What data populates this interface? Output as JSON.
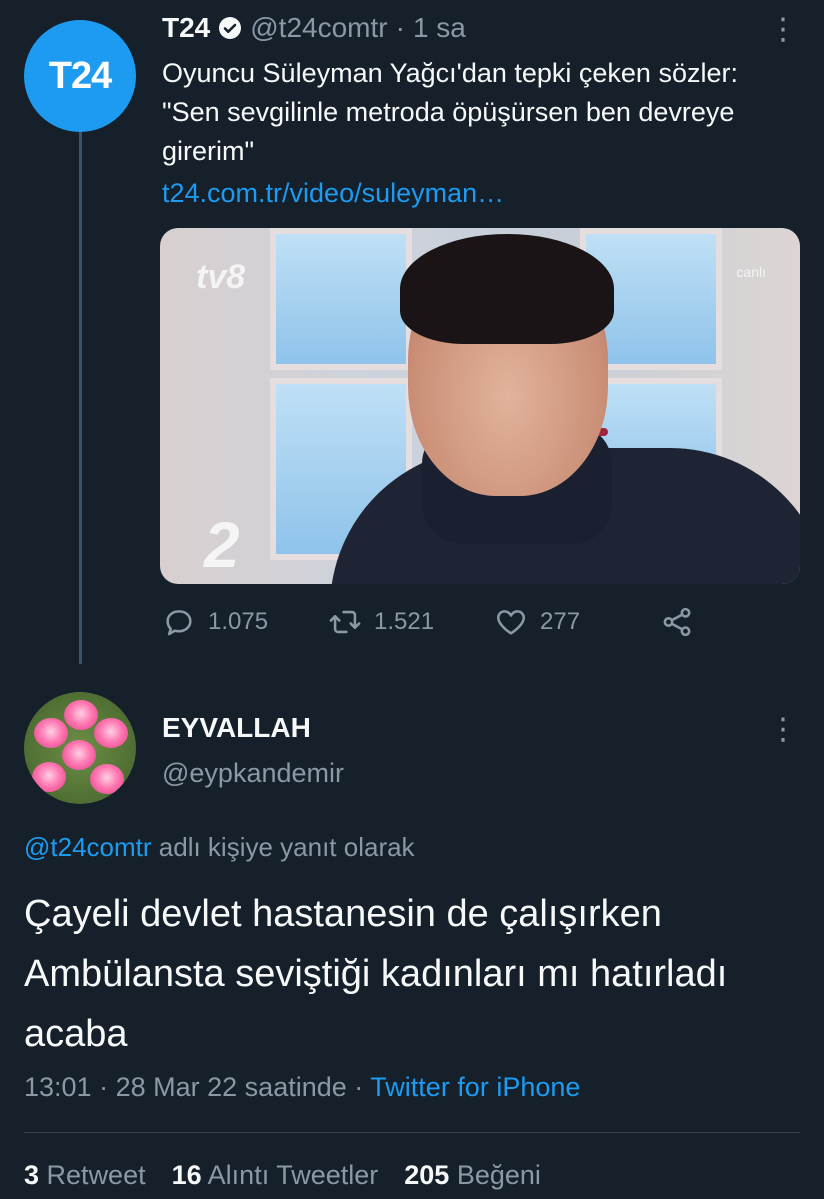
{
  "parent_tweet": {
    "avatar_text": "T24",
    "name": "T24",
    "handle": "@t24comtr",
    "separator": "·",
    "time": "1 sa",
    "text": "Oyuncu Süleyman Yağcı'dan tepki çeken sözler: \"Sen sevgilinle metroda öpüşürsen ben devreye girerim\"",
    "link": "t24.com.tr/video/suleyman…",
    "media": {
      "logo_left": "tv8",
      "logo_right": "canlı",
      "logo_bottom": "2"
    },
    "actions": {
      "replies": "1.075",
      "retweets": "1.521",
      "likes": "277"
    }
  },
  "reply_tweet": {
    "name": "EYVALLAH",
    "handle": "@eypkandemir",
    "replying_to_mention": "@t24comtr",
    "replying_to_suffix": " adlı kişiye yanıt olarak",
    "text": "Çayeli devlet hastanesin de çalışırken Ambülansta seviştiği kadınları mı hatırladı acaba",
    "time": "13:01",
    "date": "28 Mar 22 saatinde",
    "separator": "·",
    "client": "Twitter for iPhone",
    "stats": {
      "retweets_count": "3",
      "retweets_label": "Retweet",
      "quotes_count": "16",
      "quotes_label": "Alıntı Tweetler",
      "likes_count": "205",
      "likes_label": "Beğeni"
    }
  },
  "colors": {
    "background": "#15202b",
    "accent": "#1d9bf0",
    "secondary_text": "#8b98a5"
  }
}
